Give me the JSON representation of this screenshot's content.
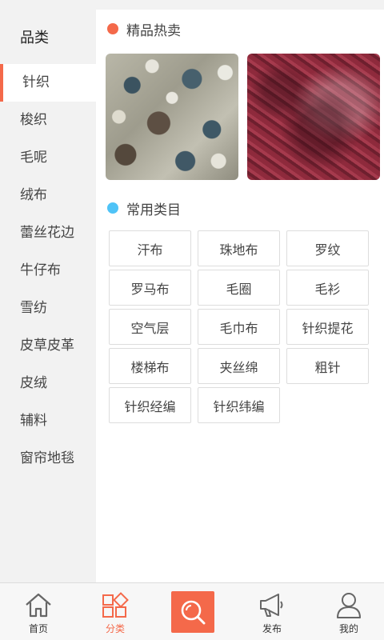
{
  "sidebar": {
    "title": "品类",
    "items": [
      {
        "label": "针织"
      },
      {
        "label": "梭织"
      },
      {
        "label": "毛呢"
      },
      {
        "label": "绒布"
      },
      {
        "label": "蕾丝花边"
      },
      {
        "label": "牛仔布"
      },
      {
        "label": "雪纺"
      },
      {
        "label": "皮草皮革"
      },
      {
        "label": "皮绒"
      },
      {
        "label": "辅料"
      },
      {
        "label": "窗帘地毯"
      }
    ],
    "active_index": 0
  },
  "hot": {
    "label": "精品热卖",
    "dot_color": "#f4694a"
  },
  "common": {
    "label": "常用类目",
    "dot_color": "#4fc3f7",
    "tags": [
      "汗布",
      "珠地布",
      "罗纹",
      "罗马布",
      "毛圈",
      "毛衫",
      "空气层",
      "毛巾布",
      "针织提花",
      "楼梯布",
      "夹丝绵",
      "粗针",
      "针织经编",
      "针织纬编"
    ]
  },
  "tabbar": {
    "home": "首页",
    "category": "分类",
    "publish": "发布",
    "mine": "我的"
  },
  "colors": {
    "accent": "#f4694a",
    "sidebar_bg": "#f2f2f2"
  }
}
